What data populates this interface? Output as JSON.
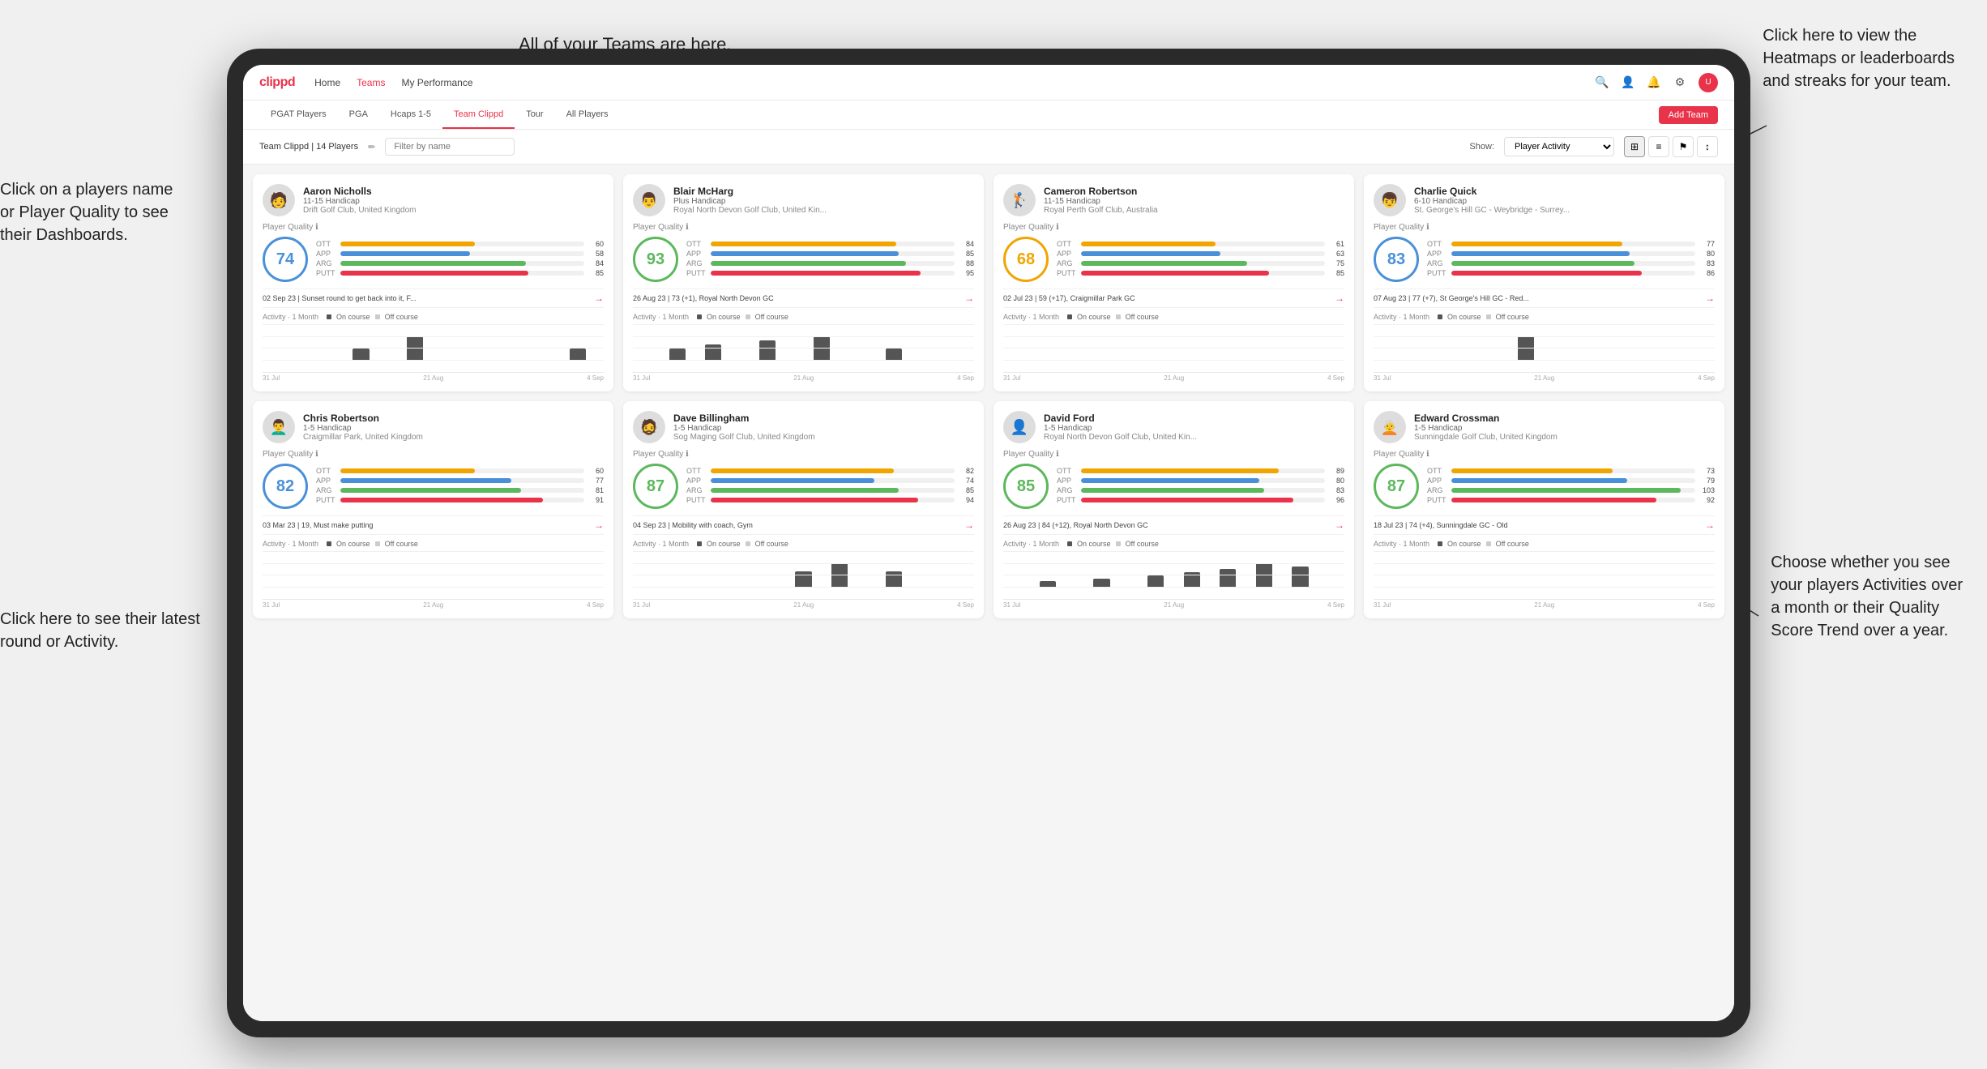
{
  "page": {
    "background": "#e8e8e8"
  },
  "annotations": {
    "teams_label": "All of your Teams are here.",
    "heatmaps_label": "Click here to view the\nHeatmaps or leaderboards\nand streaks for your team.",
    "player_name_label": "Click on a players name\nor Player Quality to see\ntheir Dashboards.",
    "latest_round_label": "Click here to see their latest\nround or Activity.",
    "activity_label": "Choose whether you see\nyour players Activities over\na month or their Quality\nScore Trend over a year."
  },
  "nav": {
    "logo": "clippd",
    "items": [
      "Home",
      "Teams",
      "My Performance"
    ],
    "active": "Teams"
  },
  "sub_nav": {
    "items": [
      "PGAT Players",
      "PGA",
      "Hcaps 1-5",
      "Team Clippd",
      "Tour",
      "All Players"
    ],
    "active": "Team Clippd",
    "add_team_label": "Add Team"
  },
  "filter_bar": {
    "team_label": "Team Clippd | 14 Players",
    "search_placeholder": "Filter by name",
    "show_label": "Show:",
    "show_value": "Player Activity",
    "view_modes": [
      "grid-2",
      "grid-3",
      "filter",
      "sort"
    ]
  },
  "players": [
    {
      "name": "Aaron Nicholls",
      "handicap": "11-15 Handicap",
      "club": "Drift Golf Club, United Kingdom",
      "quality": 74,
      "quality_color": "blue",
      "stats": {
        "OTT": {
          "value": 60,
          "color": "#f0a500"
        },
        "APP": {
          "value": 58,
          "color": "#4a90d9"
        },
        "ARG": {
          "value": 84,
          "color": "#5cb85c"
        },
        "PUTT": {
          "value": 85,
          "color": "#e8334a"
        }
      },
      "latest_round": "02 Sep 23 | Sunset round to get back into it, F...",
      "activity_bars": [
        0,
        0,
        0,
        0,
        0,
        1,
        0,
        0,
        2,
        0,
        0,
        0,
        0,
        0,
        0,
        0,
        0,
        1,
        0
      ],
      "x_labels": [
        "31 Jul",
        "21 Aug",
        "4 Sep"
      ]
    },
    {
      "name": "Blair McHarg",
      "handicap": "Plus Handicap",
      "club": "Royal North Devon Golf Club, United Kin...",
      "quality": 93,
      "quality_color": "green",
      "stats": {
        "OTT": {
          "value": 84,
          "color": "#f0a500"
        },
        "APP": {
          "value": 85,
          "color": "#4a90d9"
        },
        "ARG": {
          "value": 88,
          "color": "#5cb85c"
        },
        "PUTT": {
          "value": 95,
          "color": "#e8334a"
        }
      },
      "latest_round": "26 Aug 23 | 73 (+1), Royal North Devon GC",
      "activity_bars": [
        0,
        0,
        3,
        0,
        4,
        0,
        0,
        5,
        0,
        0,
        6,
        0,
        0,
        0,
        3,
        0,
        0,
        0,
        0
      ],
      "x_labels": [
        "31 Jul",
        "21 Aug",
        "4 Sep"
      ]
    },
    {
      "name": "Cameron Robertson",
      "handicap": "11-15 Handicap",
      "club": "Royal Perth Golf Club, Australia",
      "quality": 68,
      "quality_color": "orange",
      "stats": {
        "OTT": {
          "value": 61,
          "color": "#f0a500"
        },
        "APP": {
          "value": 63,
          "color": "#4a90d9"
        },
        "ARG": {
          "value": 75,
          "color": "#5cb85c"
        },
        "PUTT": {
          "value": 85,
          "color": "#e8334a"
        }
      },
      "latest_round": "02 Jul 23 | 59 (+17), Craigmillar Park GC",
      "activity_bars": [
        0,
        0,
        0,
        0,
        0,
        0,
        0,
        0,
        0,
        0,
        0,
        0,
        0,
        0,
        0,
        0,
        0,
        0,
        0
      ],
      "x_labels": [
        "31 Jul",
        "21 Aug",
        "4 Sep"
      ]
    },
    {
      "name": "Charlie Quick",
      "handicap": "6-10 Handicap",
      "club": "St. George's Hill GC - Weybridge - Surrey...",
      "quality": 83,
      "quality_color": "blue",
      "stats": {
        "OTT": {
          "value": 77,
          "color": "#f0a500"
        },
        "APP": {
          "value": 80,
          "color": "#4a90d9"
        },
        "ARG": {
          "value": 83,
          "color": "#5cb85c"
        },
        "PUTT": {
          "value": 86,
          "color": "#e8334a"
        }
      },
      "latest_round": "07 Aug 23 | 77 (+7), St George's Hill GC - Red...",
      "activity_bars": [
        0,
        0,
        0,
        0,
        0,
        0,
        0,
        0,
        3,
        0,
        0,
        0,
        0,
        0,
        0,
        0,
        0,
        0,
        0
      ],
      "x_labels": [
        "31 Jul",
        "21 Aug",
        "4 Sep"
      ]
    },
    {
      "name": "Chris Robertson",
      "handicap": "1-5 Handicap",
      "club": "Craigmillar Park, United Kingdom",
      "quality": 82,
      "quality_color": "blue",
      "stats": {
        "OTT": {
          "value": 60,
          "color": "#f0a500"
        },
        "APP": {
          "value": 77,
          "color": "#4a90d9"
        },
        "ARG": {
          "value": 81,
          "color": "#5cb85c"
        },
        "PUTT": {
          "value": 91,
          "color": "#e8334a"
        }
      },
      "latest_round": "03 Mar 23 | 19, Must make putting",
      "activity_bars": [
        0,
        0,
        0,
        0,
        0,
        0,
        0,
        0,
        0,
        0,
        0,
        0,
        0,
        0,
        0,
        0,
        0,
        0,
        0
      ],
      "x_labels": [
        "31 Jul",
        "21 Aug",
        "4 Sep"
      ]
    },
    {
      "name": "Dave Billingham",
      "handicap": "1-5 Handicap",
      "club": "Sog Maging Golf Club, United Kingdom",
      "quality": 87,
      "quality_color": "green",
      "stats": {
        "OTT": {
          "value": 82,
          "color": "#f0a500"
        },
        "APP": {
          "value": 74,
          "color": "#4a90d9"
        },
        "ARG": {
          "value": 85,
          "color": "#5cb85c"
        },
        "PUTT": {
          "value": 94,
          "color": "#e8334a"
        }
      },
      "latest_round": "04 Sep 23 | Mobility with coach, Gym",
      "activity_bars": [
        0,
        0,
        0,
        0,
        0,
        0,
        0,
        0,
        0,
        2,
        0,
        3,
        0,
        0,
        2,
        0,
        0,
        0,
        0
      ],
      "x_labels": [
        "31 Jul",
        "21 Aug",
        "4 Sep"
      ]
    },
    {
      "name": "David Ford",
      "handicap": "1-5 Handicap",
      "club": "Royal North Devon Golf Club, United Kin...",
      "quality": 85,
      "quality_color": "green",
      "stats": {
        "OTT": {
          "value": 89,
          "color": "#f0a500"
        },
        "APP": {
          "value": 80,
          "color": "#4a90d9"
        },
        "ARG": {
          "value": 83,
          "color": "#5cb85c"
        },
        "PUTT": {
          "value": 96,
          "color": "#e8334a"
        }
      },
      "latest_round": "26 Aug 23 | 84 (+12), Royal North Devon GC",
      "activity_bars": [
        0,
        0,
        2,
        0,
        0,
        3,
        0,
        0,
        4,
        0,
        5,
        0,
        6,
        0,
        8,
        0,
        7,
        0,
        0
      ],
      "x_labels": [
        "31 Jul",
        "21 Aug",
        "4 Sep"
      ]
    },
    {
      "name": "Edward Crossman",
      "handicap": "1-5 Handicap",
      "club": "Sunningdale Golf Club, United Kingdom",
      "quality": 87,
      "quality_color": "green",
      "stats": {
        "OTT": {
          "value": 73,
          "color": "#f0a500"
        },
        "APP": {
          "value": 79,
          "color": "#4a90d9"
        },
        "ARG": {
          "value": 103,
          "color": "#5cb85c"
        },
        "PUTT": {
          "value": 92,
          "color": "#e8334a"
        }
      },
      "latest_round": "18 Jul 23 | 74 (+4), Sunningdale GC - Old",
      "activity_bars": [
        0,
        0,
        0,
        0,
        0,
        0,
        0,
        0,
        0,
        0,
        0,
        0,
        0,
        0,
        0,
        0,
        0,
        0,
        0
      ],
      "x_labels": [
        "31 Jul",
        "21 Aug",
        "4 Sep"
      ]
    }
  ],
  "activity_legend": {
    "period": "Activity · 1 Month",
    "on_course_label": "On course",
    "off_course_label": "Off course",
    "on_course_color": "#444",
    "off_course_color": "#ccc"
  }
}
